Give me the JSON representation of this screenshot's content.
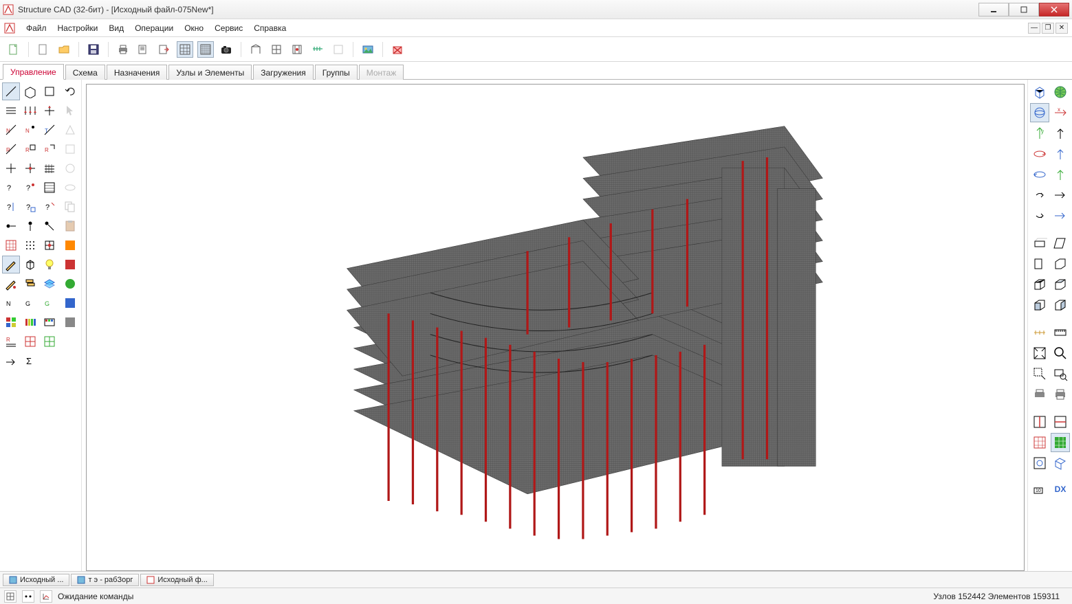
{
  "window": {
    "title": "Structure CAD (32-бит) - [Исходный файл-075New*]"
  },
  "menu": {
    "items": [
      "Файл",
      "Настройки",
      "Вид",
      "Операции",
      "Окно",
      "Сервис",
      "Справка"
    ]
  },
  "tabs": {
    "items": [
      {
        "label": "Управление",
        "active": true
      },
      {
        "label": "Схема"
      },
      {
        "label": "Назначения"
      },
      {
        "label": "Узлы и Элементы"
      },
      {
        "label": "Загружения"
      },
      {
        "label": "Группы"
      },
      {
        "label": "Монтаж",
        "disabled": true
      }
    ]
  },
  "doc_tabs": {
    "items": [
      {
        "label": "Исходный ..."
      },
      {
        "label": "т э - рабЗорг"
      },
      {
        "label": "Исходный ф..."
      }
    ]
  },
  "status": {
    "message": "Ожидание команды",
    "nodes_label": "Узлов",
    "nodes_count": "152442",
    "elements_label": "Элементов",
    "elements_count": "159311"
  },
  "right_tools": {
    "dx_label": "DX"
  }
}
